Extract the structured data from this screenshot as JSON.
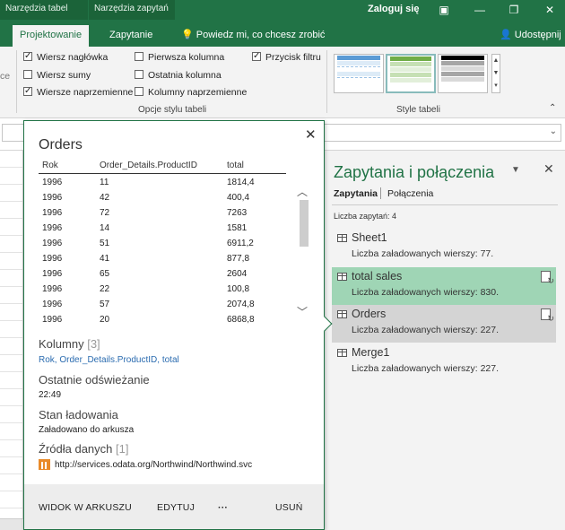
{
  "titlebar": {
    "ctx_tabs": [
      "Narzędzia tabel",
      "Narzędzia zapytań"
    ],
    "login": "Zaloguj się",
    "controls": [
      "▣",
      "—",
      "❐",
      "✕"
    ]
  },
  "tabs": {
    "items": [
      "Projektowanie",
      "Zapytanie"
    ],
    "active": "Projektowanie",
    "tellme": "Powiedz mi, co chcesz zrobić",
    "share": "Udostępnij"
  },
  "ribbon": {
    "left_stub": "ce",
    "options": {
      "header_row": "Wiersz nagłówka",
      "total_row": "Wiersz sumy",
      "banded_rows": "Wiersze naprzemienne",
      "first_column": "Pierwsza kolumna",
      "last_column": "Ostatnia kolumna",
      "banded_columns": "Kolumny naprzemienne",
      "filter_button": "Przycisk filtru"
    },
    "group_options": "Opcje stylu tabeli",
    "group_styles": "Style tabeli"
  },
  "card": {
    "title": "Orders",
    "columns": [
      "Rok",
      "Order_Details.ProductID",
      "total"
    ],
    "rows": [
      [
        "1996",
        "11",
        "1814,4"
      ],
      [
        "1996",
        "42",
        "400,4"
      ],
      [
        "1996",
        "72",
        "7263"
      ],
      [
        "1996",
        "14",
        "1581"
      ],
      [
        "1996",
        "51",
        "6911,2"
      ],
      [
        "1996",
        "41",
        "877,8"
      ],
      [
        "1996",
        "65",
        "2604"
      ],
      [
        "1996",
        "22",
        "100,8"
      ],
      [
        "1996",
        "57",
        "2074,8"
      ],
      [
        "1996",
        "20",
        "6868,8"
      ]
    ],
    "columns_label": "Kolumny",
    "columns_count": "[3]",
    "columns_list": "Rok, Order_Details.ProductID, total",
    "refresh_label": "Ostatnie odświeżanie",
    "refresh_value": "22:49",
    "load_label": "Stan ładowania",
    "load_value": "Załadowano do arkusza",
    "sources_label": "Źródła danych",
    "sources_count": "[1]",
    "source_url": "http://services.odata.org/Northwind/Northwind.svc",
    "footer": {
      "view": "WIDOK W ARKUSZU",
      "edit": "EDYTUJ",
      "more": "···",
      "delete": "USUŃ"
    }
  },
  "pane": {
    "title": "Zapytania i połączenia",
    "tab_queries": "Zapytania",
    "tab_connections": "Połączenia",
    "count": "Liczba zapytań: 4",
    "queries": [
      {
        "name": "Sheet1",
        "rows": "Liczba załadowanych wierszy: 77."
      },
      {
        "name": "total sales",
        "rows": "Liczba załadowanych wierszy: 830."
      },
      {
        "name": "Orders",
        "rows": "Liczba załadowanych wierszy: 227."
      },
      {
        "name": "Merge1",
        "rows": "Liczba załadowanych wierszy: 227."
      }
    ]
  },
  "colors": {
    "accent": "#217346",
    "highlight_green": "#9fd5b5",
    "highlight_gray": "#d4d4d4",
    "link": "#2b6cb0"
  }
}
